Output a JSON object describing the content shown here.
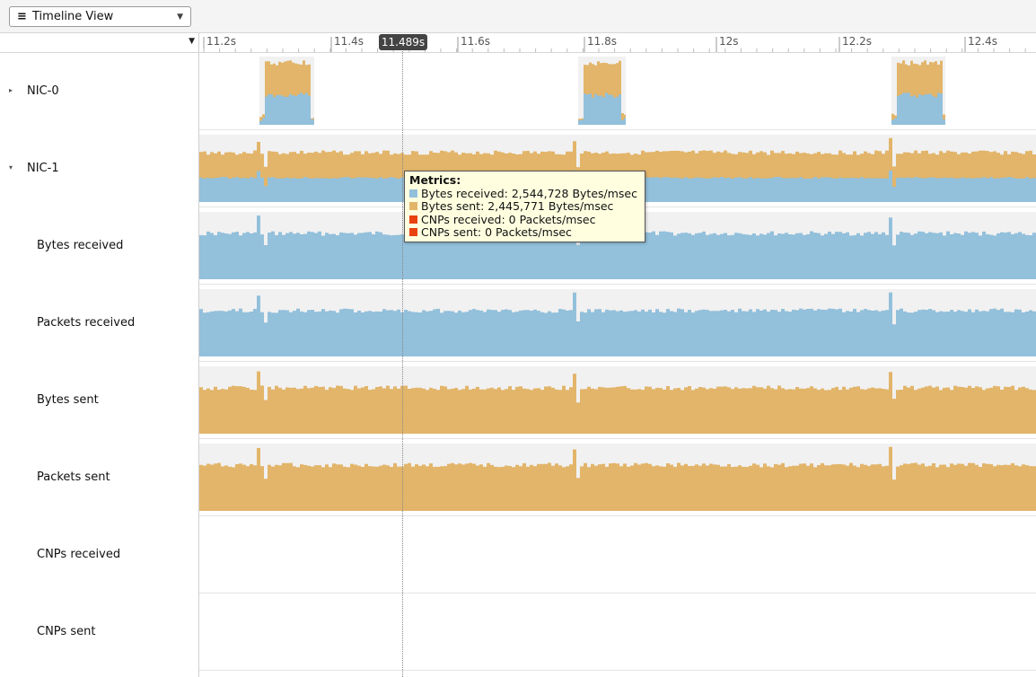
{
  "toolbar": {
    "view_menu_icon": "≡",
    "view_label": "Timeline View",
    "view_caret": "▼"
  },
  "left_panel": {
    "collapse_caret": "▼"
  },
  "ruler": {
    "ticks": [
      "11.2s",
      "11.4s",
      "11.6s",
      "11.8s",
      "12s",
      "12.2s",
      "12.4s"
    ],
    "cursor_time": "11.489s"
  },
  "tracks": [
    {
      "label": "NIC-0",
      "arrow": "▸"
    },
    {
      "label": "NIC-1",
      "arrow": "▾"
    },
    {
      "label": "Bytes received"
    },
    {
      "label": "Packets received"
    },
    {
      "label": "Bytes sent"
    },
    {
      "label": "Packets sent"
    },
    {
      "label": "CNPs received"
    },
    {
      "label": "CNPs sent"
    }
  ],
  "tooltip": {
    "title": "Metrics:",
    "rows": [
      {
        "text": "Bytes received: 2,544,728 Bytes/msec",
        "color": "#93c0db"
      },
      {
        "text": "Bytes sent: 2,445,771 Bytes/msec",
        "color": "#e2b56a"
      },
      {
        "text": "CNPs received: 0 Packets/msec",
        "color": "#e8420e"
      },
      {
        "text": "CNPs sent: 0 Packets/msec",
        "color": "#e8420e"
      }
    ]
  },
  "colors": {
    "received": "#93c0db",
    "sent": "#e2b56a",
    "cnp": "#e8420e",
    "track_bg": "#f1f1f1"
  }
}
